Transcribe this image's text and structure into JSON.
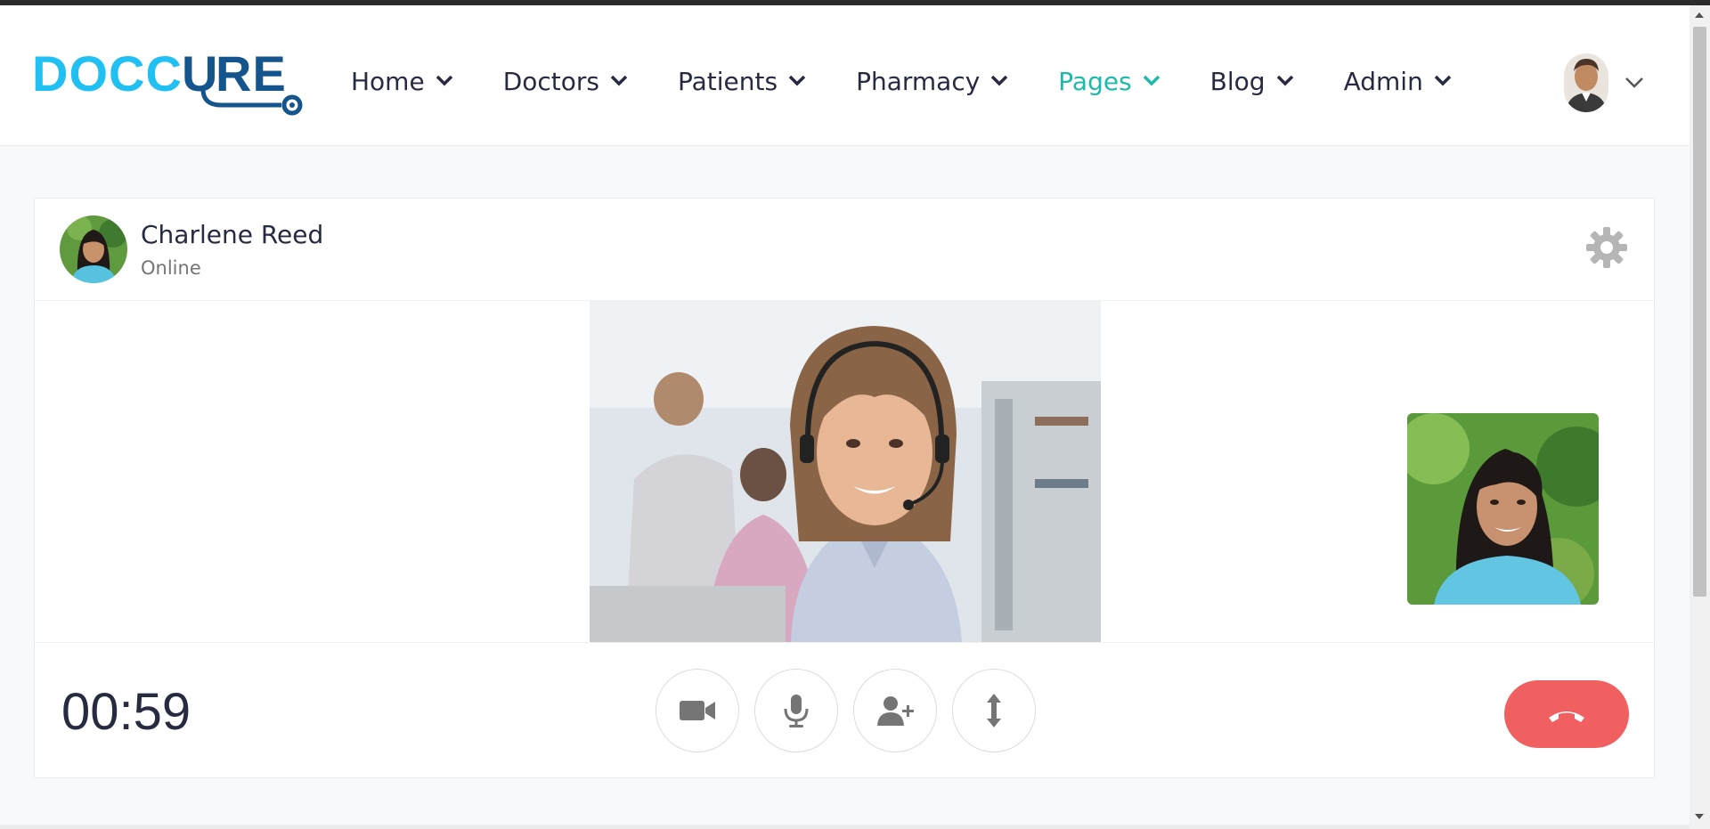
{
  "brand": {
    "logo_text": "DOCCURE",
    "accent_color": "#1db9aa",
    "logo_blue": "#20c0f3",
    "logo_dark": "#15558d"
  },
  "nav": {
    "items": [
      {
        "label": "Home",
        "active": false
      },
      {
        "label": "Doctors",
        "active": false
      },
      {
        "label": "Patients",
        "active": false
      },
      {
        "label": "Pharmacy",
        "active": false
      },
      {
        "label": "Pages",
        "active": true
      },
      {
        "label": "Blog",
        "active": false
      },
      {
        "label": "Admin",
        "active": false
      }
    ]
  },
  "call": {
    "caller_name": "Charlene Reed",
    "caller_status": "Online",
    "timer": "00:59",
    "controls": [
      "video-camera-icon",
      "microphone-icon",
      "add-user-icon",
      "resize-vertical-icon"
    ],
    "end_call_color": "#f06060"
  }
}
